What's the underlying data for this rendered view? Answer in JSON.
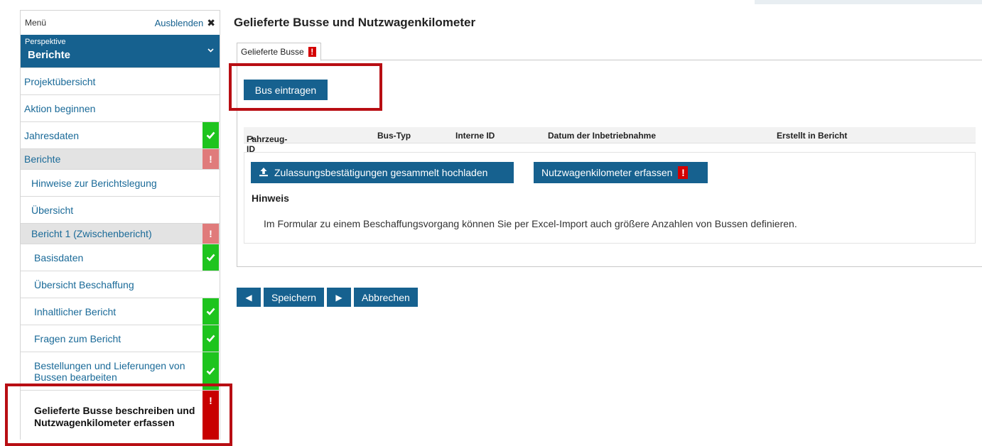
{
  "sidebar": {
    "menu_title": "Menü",
    "hide_label": "Ausblenden",
    "perspective_label": "Perspektive",
    "perspective_value": "Berichte",
    "items": [
      {
        "label": "Projektübersicht",
        "status": ""
      },
      {
        "label": "Aktion beginnen",
        "status": ""
      },
      {
        "label": "Jahresdaten",
        "status": "ok"
      },
      {
        "label": "Berichte",
        "status": "warning"
      },
      {
        "label": "Hinweise zur Berichtslegung",
        "status": ""
      },
      {
        "label": "Übersicht",
        "status": ""
      },
      {
        "label": "Bericht 1 (Zwischenbericht)",
        "status": "warning"
      },
      {
        "label": "Basisdaten",
        "status": "ok"
      },
      {
        "label": "Übersicht Beschaffung",
        "status": ""
      },
      {
        "label": "Inhaltlicher Bericht",
        "status": "ok"
      },
      {
        "label": "Fragen zum Bericht",
        "status": "ok"
      },
      {
        "label": "Bestellungen und Lieferungen von Bussen bearbeiten",
        "status": "ok"
      },
      {
        "label": "Gelieferte Busse beschreiben und Nutzwagenkilometer erfassen",
        "status": "error"
      }
    ]
  },
  "main": {
    "title": "Gelieferte Busse und Nutzwagenkilometer",
    "tab_label": "Gelieferte Busse",
    "add_bus_label": "Bus eintragen",
    "columns": [
      "Fahrzeug-ID",
      "Bus-Typ",
      "Interne ID",
      "Datum der Inbetriebnahme",
      "Erstellt in Bericht"
    ],
    "upload_label": "Zulassungsbestätigungen gesammelt hochladen",
    "km_label": "Nutzwagenkilometer erfassen",
    "hint_title": "Hinweis",
    "hint_text": "Im Formular zu einem Beschaffungsvorgang können Sie per Excel-Import auch größere Anzahlen von Bussen definieren."
  },
  "footer": {
    "save_label": "Speichern",
    "cancel_label": "Abbrechen"
  },
  "icons": {
    "ok": "check-icon",
    "warning": "exclamation-icon",
    "error": "exclamation-icon",
    "upload": "upload-icon",
    "prev": "arrow-left-icon",
    "next": "arrow-right-icon"
  },
  "colors": {
    "primary": "#16618f",
    "ok": "#1ec41e",
    "warning": "#e07b7b",
    "error": "#c80000",
    "highlight": "#b80e13"
  }
}
